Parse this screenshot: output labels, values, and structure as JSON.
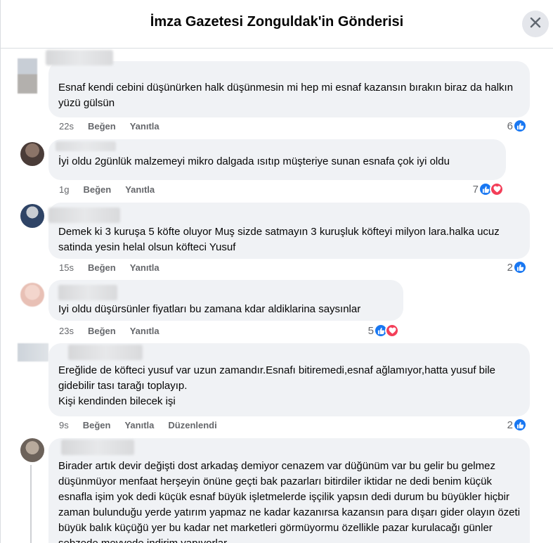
{
  "header": {
    "title": "İmza Gazetesi Zonguldak'in Gönderisi"
  },
  "comments": [
    {
      "text": "Esnaf kendi cebini düşünürken halk düşünmesin mi hep mi esnaf kazansın bırakın biraz da halkın yüzü gülsün",
      "time": "22s",
      "like_label": "Beğen",
      "reply_label": "Yanıtla",
      "reaction_count": "6"
    },
    {
      "name_partial": "Nazif Yilmaz",
      "text": "İyi oldu 2günlük malzemeyi mikro dalgada ısıtıp müşteriye sunan esnafa çok iyi oldu",
      "time": "1g",
      "like_label": "Beğen",
      "reply_label": "Yanıtla",
      "reaction_count": "7"
    },
    {
      "text": "Demek ki 3 kuruşa 5 köfte oluyor Muş sizde satmayın 3 kuruşluk köfteyi milyon lara.halka ucuz satinda yesin helal olsun köfteci Yusuf",
      "time": "15s",
      "like_label": "Beğen",
      "reply_label": "Yanıtla",
      "reaction_count": "2"
    },
    {
      "text": "Iyi oldu düşürsünler fiyatları bu zamana kdar aldiklarina saysınlar",
      "time": "23s",
      "like_label": "Beğen",
      "reply_label": "Yanıtla",
      "reaction_count": "5"
    },
    {
      "text": "Ereğlide de köfteci yusuf var uzun zamandır.Esnafı bitiremedi,esnaf ağlamıyor,hatta yusuf bile gidebilir tası tarağı toplayıp.\nKişi kendinden bilecek işi",
      "time": "9s",
      "like_label": "Beğen",
      "reply_label": "Yanıtla",
      "edited_label": "Düzenlendi",
      "reaction_count": "2"
    },
    {
      "text": "Birader artık devir değişti dost arkadaş demiyor cenazem var düğünüm var bu gelir bu gelmez düşünmüyor menfaat herşeyin önüne geçti bak pazarları bitirdiler iktidar ne dedi benim küçük esnafla işim yok dedi küçük esnaf büyük işletmelerde işçilik yapsın dedi durum bu büyükler hiçbir zaman bulunduğu yerde yatırım yapmaz ne kadar kazanırsa kazansın para dışarı gider olayın özeti büyük balık küçüğü yer bu kadar net marketleri görmüyormu özellikle pazar kurulacağı günler sebzede meyvede indirim yapıyorlar"
    }
  ],
  "colors": {
    "bubble": "#f0f2f5",
    "like_blue": "#1877f2",
    "love_red": "#f33e58",
    "meta_gray": "#65676b"
  }
}
